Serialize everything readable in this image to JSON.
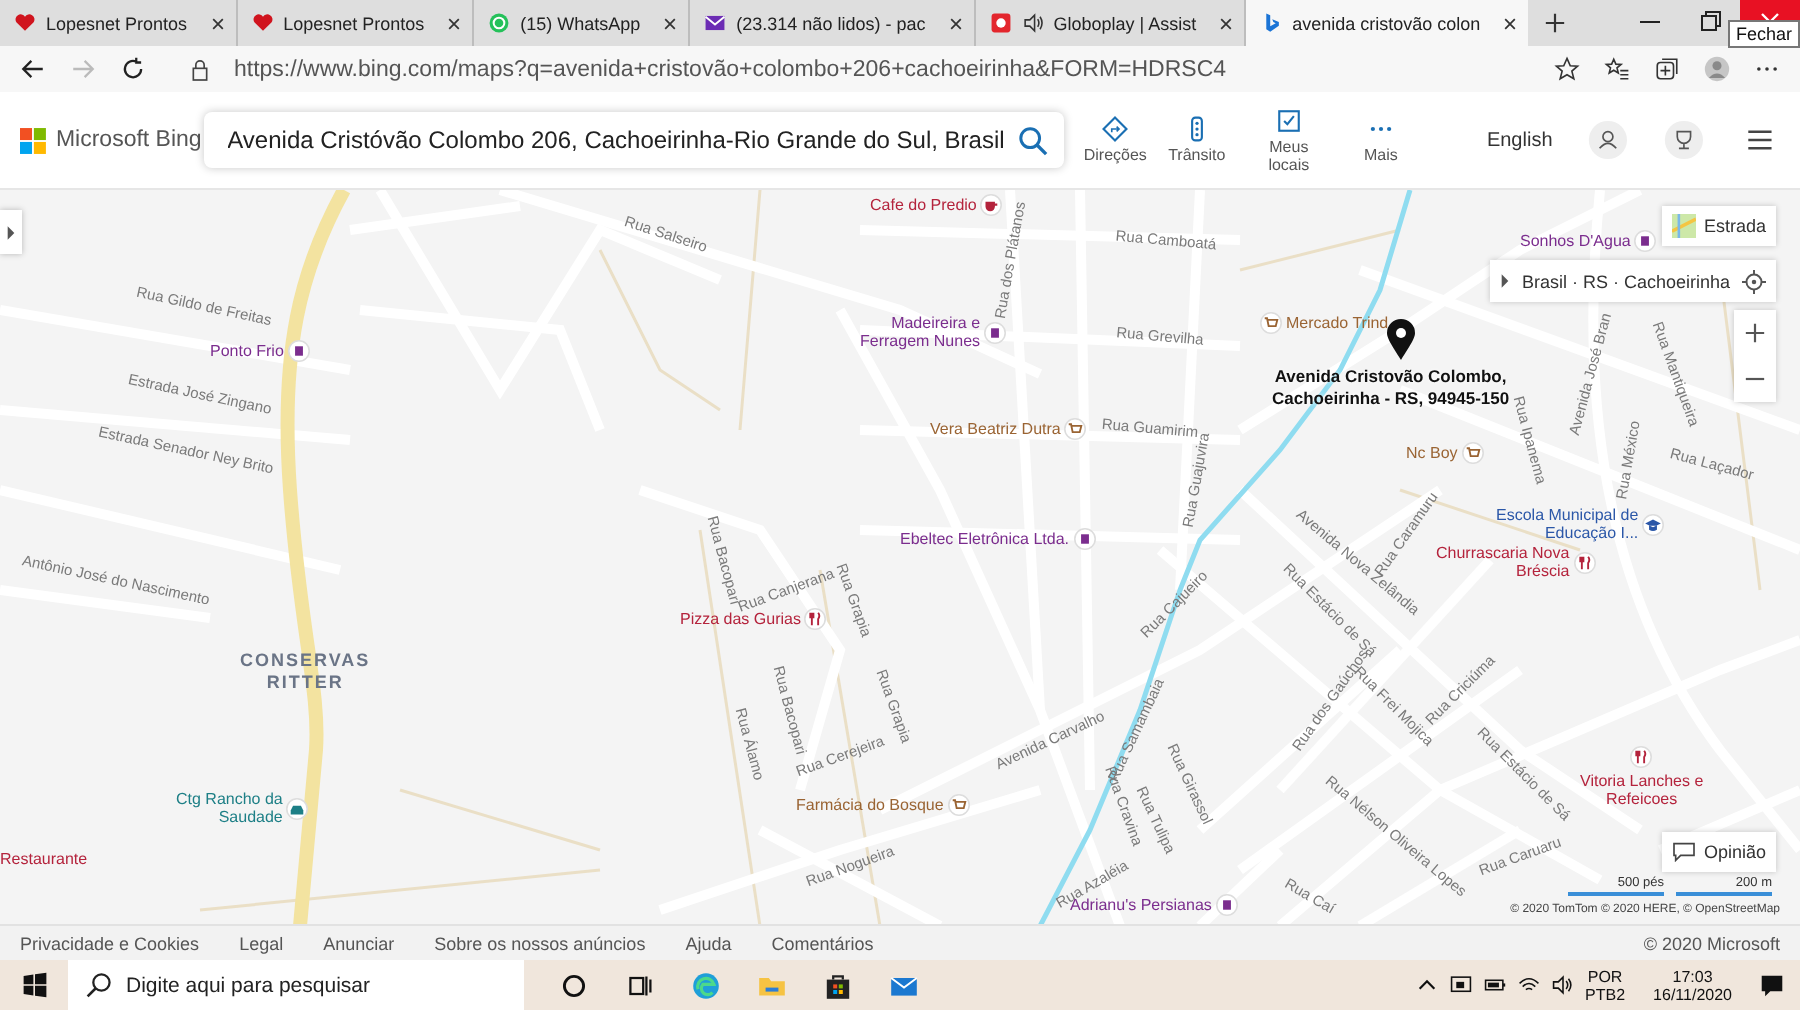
{
  "browser": {
    "tabs": [
      {
        "title": "Lopesnet Prontos",
        "playing_audio": false,
        "selected": false
      },
      {
        "title": "Lopesnet Prontos",
        "playing_audio": false,
        "selected": false
      },
      {
        "title": "(15) WhatsApp",
        "playing_audio": false,
        "selected": false
      },
      {
        "title": "(23.314 não lidos) - pac",
        "playing_audio": false,
        "selected": false
      },
      {
        "title": "Globoplay | Assist",
        "playing_audio": true,
        "selected": false
      },
      {
        "title": "avenida cristovão colon",
        "playing_audio": false,
        "selected": true
      }
    ],
    "close_tooltip": "Fechar",
    "url": "https://www.bing.com/maps?q=avenida+cristovão+colombo+206+cachoeirinha&FORM=HDRSC4"
  },
  "header": {
    "logo": "Microsoft Bing",
    "search": {
      "value": "Avenida Cristóvão Colombo 206, Cachoeirinha-Rio Grande do Sul, Brasil"
    },
    "nav": [
      {
        "label": "Direções"
      },
      {
        "label": "Trânsito"
      },
      {
        "label": "Meus locais"
      },
      {
        "label": "Mais"
      }
    ],
    "language": "English"
  },
  "map": {
    "area_label": "CONSERVAS\nRITTER",
    "streets": [
      "Rua Salseiro",
      "Rua Gildo de Freitas",
      "Estrada José Zingano",
      "Estrada Senador Ney Brito",
      "Antônio José do Nascimento",
      "Rua Camboatá",
      "Rua dos Plátanos",
      "Rua Grevilha",
      "Rua Guamirim",
      "Rua Guajuvira",
      "Rua Cajueiro",
      "Avenida Carvalho",
      "Rua Samambaia",
      "Rua Girassol",
      "Rua Tulipa",
      "Rua Cravina",
      "Rua Azaléia",
      "Rua Caí",
      "Avenida Nova Zelândia",
      "Rua Estácio de Sá",
      "Rua Caramuru",
      "Rua dos Gaúchos",
      "Rua Frei Mojica",
      "Rua Criciúma",
      "Rua Estácio de Sá",
      "Rua Nélson Oliveira Lopes",
      "Rua Caruaru",
      "Rua Ipanema",
      "Avenida José Bran",
      "Rua México",
      "Rua Laçador",
      "Rua Mantiqueira",
      "Rua Bacopari",
      "Rua Canjerana",
      "Rua Grapia",
      "Rua Grapia",
      "Rua Bacopari",
      "Rua Álamo",
      "Rua Cerejeira",
      "Rua Nogueira"
    ],
    "places": [
      {
        "name": "Cafe do Predio",
        "kind": "cafe"
      },
      {
        "name": "Ponto Frio",
        "kind": "shop"
      },
      {
        "name": "Madeireira e\nFerragem Nunes",
        "kind": "shop"
      },
      {
        "name": "Vera Beatriz Dutra",
        "kind": "market"
      },
      {
        "name": "Ebeltec Eletrônica Ltda.",
        "kind": "shop"
      },
      {
        "name": "Pizza das Gurias",
        "kind": "restaurant"
      },
      {
        "name": "Ctg Rancho da\nSaudade",
        "kind": "leisure"
      },
      {
        "name": "Farmácia do Bosque",
        "kind": "market"
      },
      {
        "name": "Restaurante",
        "kind": "restaurant"
      },
      {
        "name": "Mercado Trind",
        "kind": "market"
      },
      {
        "name": "Sonhos D'Agua",
        "kind": "shop"
      },
      {
        "name": "Nc Boy",
        "kind": "market"
      },
      {
        "name": "Escola Municipal de\nEducação I...",
        "kind": "school"
      },
      {
        "name": "Churrascaria Nova\nBréscia",
        "kind": "restaurant"
      },
      {
        "name": "Vitoria Lanches e\nRefeicoes",
        "kind": "restaurant"
      },
      {
        "name": "Adrianu's Persianas",
        "kind": "shop"
      }
    ],
    "pin_label": "Avenida Cristovão Colombo,\nCachoeirinha - RS, 94945-150",
    "style_button": "Estrada",
    "breadcrumb": "Brasil · RS · Cachoeirinha",
    "feedback": "Opinião",
    "scale": [
      "500 pés",
      "200 m"
    ],
    "attribution": "© 2020 TomTom © 2020 HERE, © OpenStreetMap"
  },
  "footer": {
    "links": [
      "Privacidade e Cookies",
      "Legal",
      "Anunciar",
      "Sobre os nossos anúncios",
      "Ajuda",
      "Comentários"
    ],
    "copyright": "© 2020 Microsoft"
  },
  "taskbar": {
    "search_placeholder": "Digite aqui para pesquisar",
    "language": "POR",
    "layout": "PTB2",
    "time": "17:03",
    "date": "16/11/2020"
  }
}
